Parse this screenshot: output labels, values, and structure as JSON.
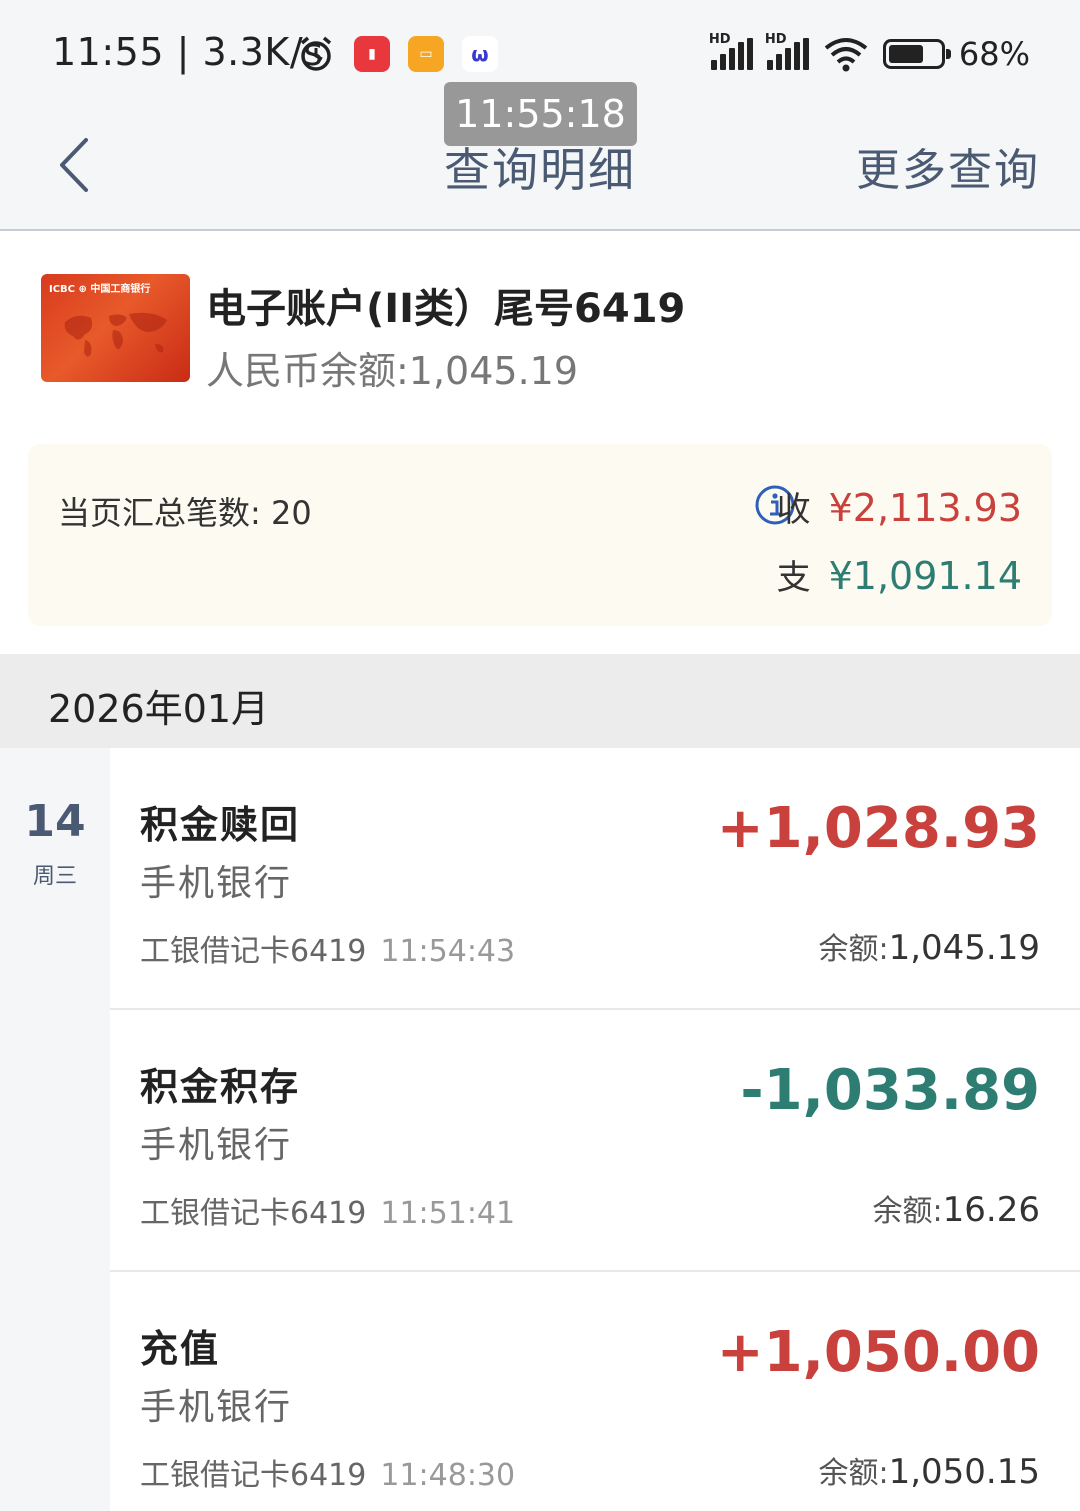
{
  "status_bar": {
    "time": "11:55 | 3.3K/s",
    "battery": "68%",
    "icons": [
      "alarm-icon",
      "unionpay-app-icon",
      "notes-app-icon",
      "app-icon",
      "signal-hd-icon",
      "signal-hd-icon",
      "wifi-icon",
      "battery-icon"
    ]
  },
  "overlay_time": "11:55:18",
  "header": {
    "title": "查询明细",
    "more_label": "更多查询"
  },
  "account": {
    "name": "电子账户(II类）尾号6419",
    "balance": "人民币余额:1,045.19",
    "card_brand": "ICBC ⊕ 中国工商银行"
  },
  "summary": {
    "count_label": "当页汇总笔数: 20",
    "income_label": "收",
    "income_value": "¥2,113.93",
    "expense_label": "支",
    "expense_value": "¥1,091.14"
  },
  "month": "2026年01月",
  "date": {
    "day": "14",
    "weekday": "周三"
  },
  "transactions": [
    {
      "title": "积金赎回",
      "channel": "手机银行",
      "card": "工银借记卡6419",
      "time": "11:54:43",
      "amount": "+1,028.93",
      "balance_label": "余额:",
      "balance": "1,045.19"
    },
    {
      "title": "积金积存",
      "channel": "手机银行",
      "card": "工银借记卡6419",
      "time": "11:51:41",
      "amount": "-1,033.89",
      "balance_label": "余额:",
      "balance": "16.26"
    },
    {
      "title": "充值",
      "channel": "手机银行",
      "card": "工银借记卡6419",
      "time": "11:48:30",
      "amount": "+1,050.00",
      "balance_label": "余额:",
      "balance": "1,050.15"
    }
  ],
  "colors": {
    "income": "#c8413c",
    "expense": "#2e7d73",
    "header_text": "#4a5a72"
  }
}
